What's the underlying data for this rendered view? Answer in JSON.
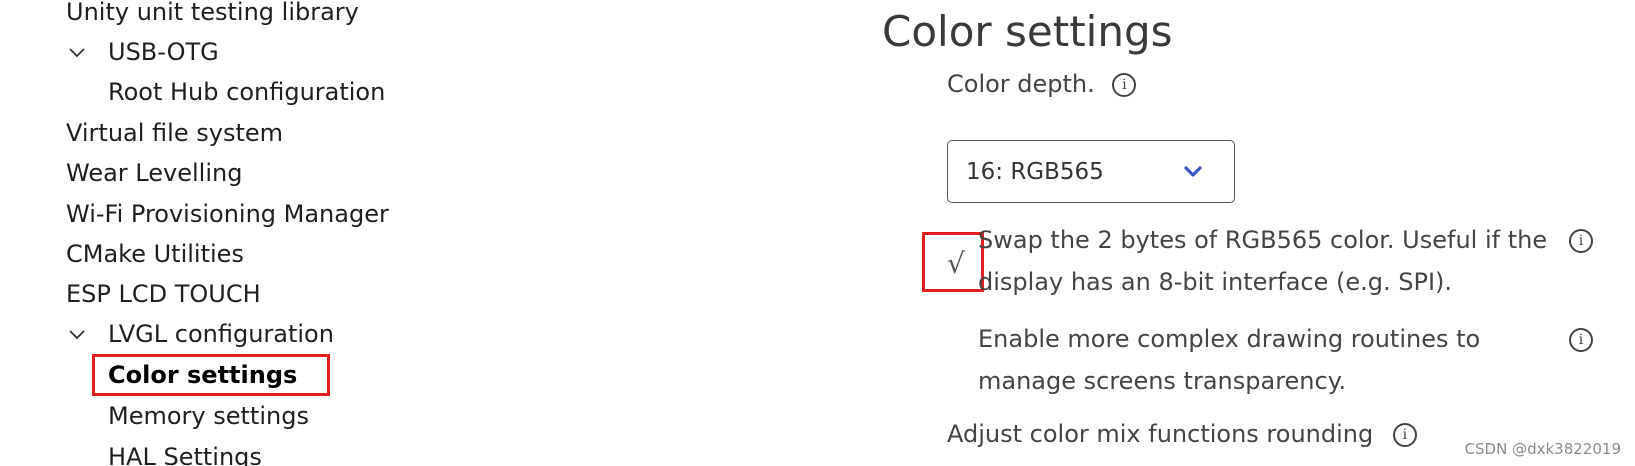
{
  "sidebar": {
    "items": [
      {
        "label": "Unity unit testing library"
      },
      {
        "label": "USB-OTG"
      },
      {
        "label": "Root Hub configuration"
      },
      {
        "label": "Virtual file system"
      },
      {
        "label": "Wear Levelling"
      },
      {
        "label": "Wi-Fi Provisioning Manager"
      },
      {
        "label": "CMake Utilities"
      },
      {
        "label": "ESP LCD TOUCH"
      },
      {
        "label": "LVGL configuration"
      },
      {
        "label": "Color settings"
      },
      {
        "label": "Memory settings"
      },
      {
        "label": "HAL Settings"
      }
    ]
  },
  "panel": {
    "title": "Color settings",
    "color_depth_label": "Color depth.",
    "color_depth_value": "16: RGB565",
    "swap_line1": "Swap the 2 bytes of RGB565 color. Useful if the",
    "swap_line2": "display has an 8-bit interface (e.g. SPI).",
    "swap_checked": true,
    "swap_check_glyph": "√",
    "complex_line1": "Enable more complex drawing routines to",
    "complex_line2": "manage screens transparency.",
    "mix_label": "Adjust color mix functions rounding",
    "info_glyph": "i"
  },
  "watermark": "CSDN @dxk3822019",
  "colors": {
    "highlight_border": "#e02020",
    "select_chevron": "#3b55c7"
  }
}
